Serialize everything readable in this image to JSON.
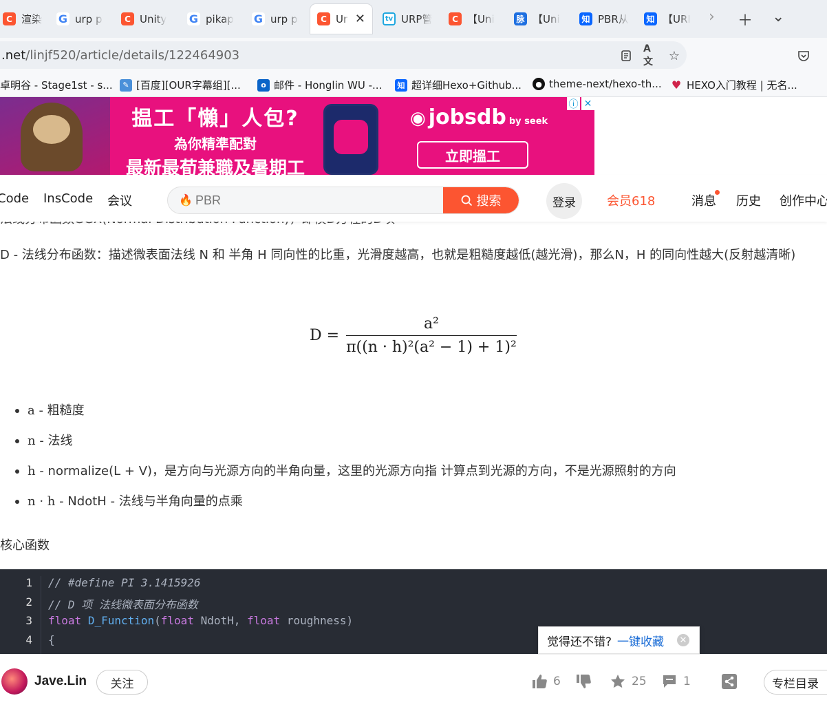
{
  "browser": {
    "tabs": [
      {
        "label": "渲染务",
        "icon": "csdn"
      },
      {
        "label": "urp pi",
        "icon": "google"
      },
      {
        "label": "Unity",
        "icon": "csdn"
      },
      {
        "label": "pikap",
        "icon": "google"
      },
      {
        "label": "urp pi",
        "icon": "google"
      },
      {
        "label": "Uni",
        "icon": "csdn",
        "active": true
      },
      {
        "label": "URP管",
        "icon": "bilibili"
      },
      {
        "label": "【Uni",
        "icon": "csdn"
      },
      {
        "label": "【Uni",
        "icon": "maimai"
      },
      {
        "label": "PBR从",
        "icon": "zhihu"
      },
      {
        "label": "【URI",
        "icon": "zhihu"
      }
    ],
    "url_host": ".net",
    "url_path": "/linjf520/article/details/122464903",
    "bookmarks": [
      {
        "label": "卓明谷 - Stage1st - s...",
        "icon": "none"
      },
      {
        "label": "[百度][OUR字幕组][...",
        "icon": "feather"
      },
      {
        "label": "邮件 - Honglin WU -...",
        "icon": "outlook"
      },
      {
        "label": "超详细Hexo+Github...",
        "icon": "zhihu"
      },
      {
        "label": "theme-next/hexo-th...",
        "icon": "github"
      },
      {
        "label": "HEXO入门教程 | 无名...",
        "icon": "hexo"
      }
    ]
  },
  "ad": {
    "line1": "揾工「懶」人包?",
    "line2": "為你精準配對",
    "line3": "最新最荀兼職及暑期工",
    "brand": "jobsdb",
    "brand_sub": "by seek",
    "cta": "立即搵工"
  },
  "toolbar": {
    "nav": [
      "Code",
      "InsCode",
      "会议"
    ],
    "search_placeholder": "PBR",
    "search_button": "搜索",
    "login": "登录",
    "vip": "会员618",
    "right": [
      "消息",
      "历史",
      "创作中心"
    ]
  },
  "article": {
    "cut_line": "法线分布函数GGX(Normal Distribution Function)，即模D方程的D项",
    "para": "D - 法线分布函数：描述微表面法线 N 和 半角 H 同向性的比重，光滑度越高，也就是粗糙度越低(越光滑)，那么N，H 的同向性越大(反射越清晰)",
    "formula": {
      "lhs": "D =",
      "num": "a²",
      "den": "π((n · h)²(a² − 1) + 1)²"
    },
    "bullets": [
      {
        "sym": "a",
        "text": " - 粗糙度"
      },
      {
        "sym": "n",
        "text": " - 法线"
      },
      {
        "sym": "h",
        "text": " - normalize(L + V)，是方向与光源方向的半角向量，这里的光源方向指 计算点到光源的方向，不是光源照射的方向"
      },
      {
        "sym": "n · h",
        "text": " - NdotH - 法线与半角向量的点乘"
      }
    ],
    "core_heading": "核心函数"
  },
  "code": {
    "line_numbers": [
      "1",
      "2",
      "3",
      "4"
    ],
    "line1": "// #define PI 3.1415926",
    "line2": "// D 项 法线微表面分布函数",
    "line3_kw1": "float",
    "line3_fn": "D_Function",
    "line3_p1": "(",
    "line3_kw2": "float",
    "line3_arg1": " NdotH, ",
    "line3_kw3": "float",
    "line3_arg2": " roughness)",
    "line4": "{"
  },
  "collect_tip": {
    "text": "觉得还不错?",
    "link": "一键收藏"
  },
  "author_bar": {
    "name": "Jave.Lin",
    "follow": "关注",
    "likes": "6",
    "stars": "25",
    "comments": "1",
    "column": "专栏目录"
  },
  "colors": {
    "accent": "#fc5531",
    "code_bg": "#282c34",
    "ad_bg": "#e8117e"
  }
}
